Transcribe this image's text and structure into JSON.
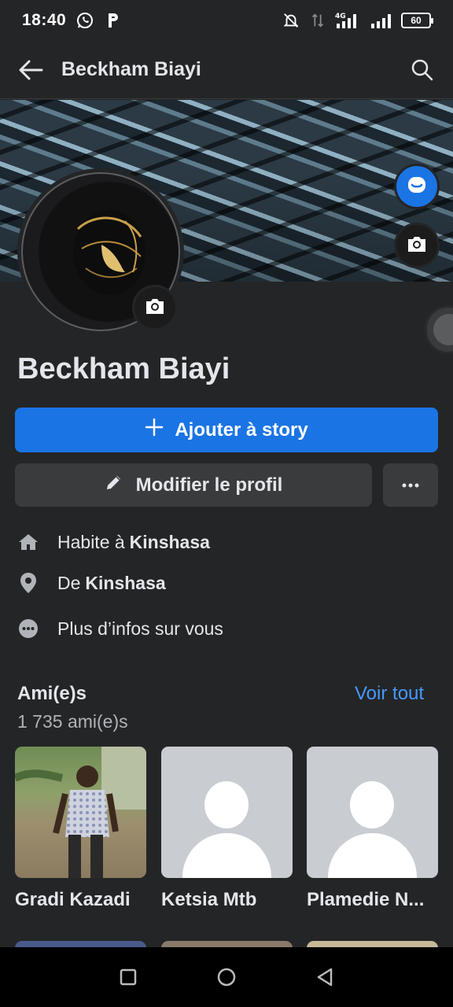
{
  "status_bar": {
    "time": "18:40",
    "network": "4G",
    "battery": "60"
  },
  "app_bar": {
    "title": "Beckham Biayi"
  },
  "profile": {
    "name": "Beckham Biayi"
  },
  "actions": {
    "add_story": "Ajouter à story",
    "edit_profile": "Modifier le profil"
  },
  "details": {
    "lives_prefix": "Habite à",
    "lives_city": "Kinshasa",
    "from_prefix": "De",
    "from_city": "Kinshasa",
    "more_info": "Plus d’infos sur vous"
  },
  "friends": {
    "title": "Ami(e)s",
    "count": "1 735 ami(e)s",
    "see_all": "Voir tout",
    "items": [
      {
        "name": "Gradi Kazadi"
      },
      {
        "name": "Ketsia Mtb"
      },
      {
        "name": "Plamedie N..."
      }
    ]
  },
  "colors": {
    "accent": "#1b74e4",
    "link": "#4599ff",
    "background": "#242526",
    "button_gray": "#3a3b3c"
  }
}
